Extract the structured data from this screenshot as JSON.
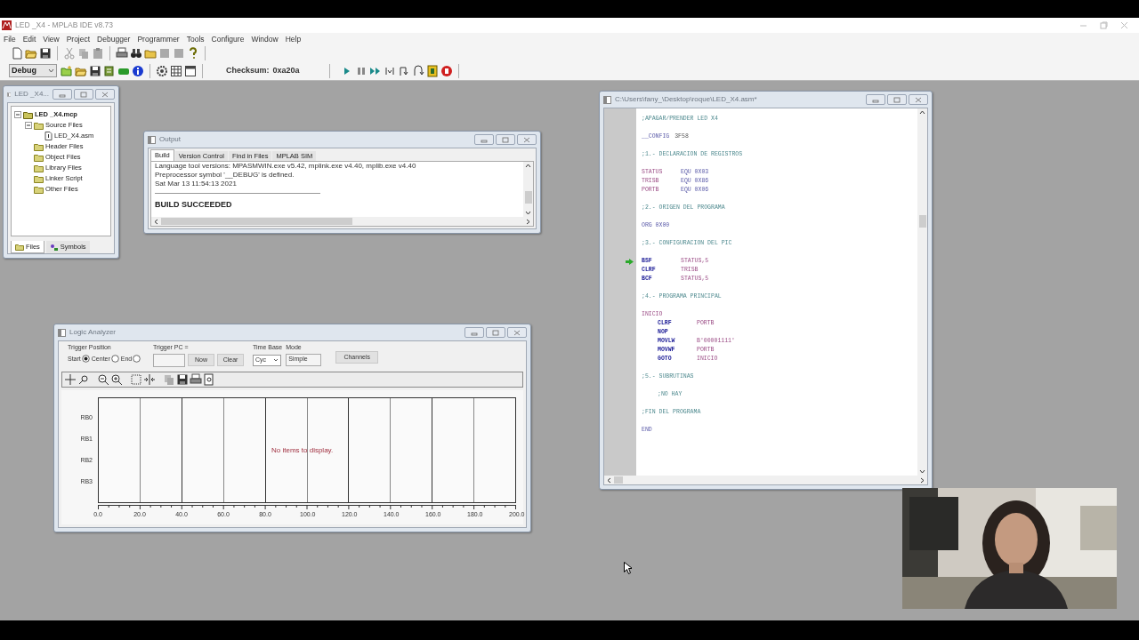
{
  "app": {
    "title": "LED _X4 - MPLAB IDE v8.73"
  },
  "menu": [
    "File",
    "Edit",
    "View",
    "Project",
    "Debugger",
    "Programmer",
    "Tools",
    "Configure",
    "Window",
    "Help"
  ],
  "toolbar": {
    "config": "Debug",
    "checksum_label": "Checksum:",
    "checksum": "0xa20a"
  },
  "project_window": {
    "title": "LED _X4...",
    "tree": [
      {
        "label": "LED _X4.mcp",
        "kind": "project",
        "expanded": true,
        "children": [
          {
            "label": "Source Files",
            "kind": "folder",
            "expanded": true,
            "children": [
              {
                "label": "LED_X4.asm",
                "kind": "file"
              }
            ]
          },
          {
            "label": "Header Files",
            "kind": "folder"
          },
          {
            "label": "Object Files",
            "kind": "folder"
          },
          {
            "label": "Library Files",
            "kind": "folder"
          },
          {
            "label": "Linker Script",
            "kind": "folder"
          },
          {
            "label": "Other Files",
            "kind": "folder"
          }
        ]
      }
    ],
    "tabs": [
      {
        "label": "Files",
        "selected": true
      },
      {
        "label": "Symbols",
        "selected": false
      }
    ]
  },
  "output_window": {
    "title": "Output",
    "tabs": [
      {
        "label": "Build",
        "selected": true
      },
      {
        "label": "Version Control",
        "selected": false
      },
      {
        "label": "Find in Files",
        "selected": false
      },
      {
        "label": "MPLAB SIM",
        "selected": false
      }
    ],
    "lines": [
      "Language tool versions: MPASMWIN.exe v5.42, mplink.exe v4.40, mplib.exe v4.40",
      "Preprocessor symbol '__DEBUG' is defined.",
      "Sat Mar 13 11:54:13 2021"
    ],
    "result": "BUILD SUCCEEDED"
  },
  "logic_analyzer": {
    "title": "Logic Analyzer",
    "trigger_position": {
      "label": "Trigger Position",
      "options": [
        {
          "label": "Start",
          "selected": true
        },
        {
          "label": "Center",
          "selected": false
        },
        {
          "label": "End",
          "selected": false
        }
      ]
    },
    "trigger_pc_label": "Trigger PC =",
    "now_button": "Now",
    "clear_button": "Clear",
    "time_base": {
      "label": "Time Base",
      "value": "Cyc"
    },
    "mode": {
      "label": "Mode",
      "value": "Simple"
    },
    "channels_button": "Channels",
    "channels": [
      "RB0",
      "RB1",
      "RB2",
      "RB3"
    ],
    "x_labels": [
      "0.0",
      "20.0",
      "40.0",
      "60.0",
      "80.0",
      "100.0",
      "120.0",
      "140.0",
      "160.0",
      "180.0",
      "200.0"
    ],
    "empty_message": "No items to display."
  },
  "editor": {
    "title": "C:\\Users\\fany_\\Desktop\\roque\\LED_X4.asm*",
    "lines": [
      {
        "kind": "code",
        "current": false,
        "tokens": [
          {
            "text": ";APAGAR/PRENDER LED X4",
            "kind": "comment"
          }
        ]
      },
      {
        "kind": "blank",
        "current": false
      },
      {
        "kind": "code",
        "current": false,
        "tokens": [
          {
            "text": "__CONFIG",
            "kind": "directive"
          },
          {
            "text": "3F58",
            "kind": "number"
          }
        ]
      },
      {
        "kind": "blank",
        "current": false
      },
      {
        "kind": "code",
        "current": false,
        "tokens": [
          {
            "text": ";1.- DECLARACION DE REGISTROS",
            "kind": "comment"
          }
        ]
      },
      {
        "kind": "blank",
        "current": false
      },
      {
        "kind": "code",
        "current": false,
        "tokens": [
          {
            "text": "STATUS",
            "kind": "symbol"
          },
          {
            "text": "EQU 0X03",
            "kind": "directive"
          }
        ]
      },
      {
        "kind": "code",
        "current": false,
        "tokens": [
          {
            "text": "TRISB",
            "kind": "symbol"
          },
          {
            "text": "EQU 0X86",
            "kind": "directive"
          }
        ]
      },
      {
        "kind": "code",
        "current": false,
        "tokens": [
          {
            "text": "PORTB",
            "kind": "symbol"
          },
          {
            "text": "EQU 0X06",
            "kind": "directive"
          }
        ]
      },
      {
        "kind": "blank",
        "current": false
      },
      {
        "kind": "code",
        "current": false,
        "tokens": [
          {
            "text": ";2.- ORIGEN DEL PROGRAMA",
            "kind": "comment"
          }
        ]
      },
      {
        "kind": "blank",
        "current": false
      },
      {
        "kind": "code",
        "current": false,
        "tokens": [
          {
            "text": "ORG 0X00",
            "kind": "directive"
          }
        ]
      },
      {
        "kind": "blank",
        "current": false
      },
      {
        "kind": "code",
        "current": false,
        "tokens": [
          {
            "text": ";3.- CONFIGURACION DEL PIC",
            "kind": "comment"
          }
        ]
      },
      {
        "kind": "blank",
        "current": false
      },
      {
        "kind": "code",
        "current": true,
        "tokens": [
          {
            "text": "BSF",
            "kind": "instruction"
          },
          {
            "text": "STATUS,5",
            "kind": "symbol"
          }
        ]
      },
      {
        "kind": "code",
        "current": false,
        "tokens": [
          {
            "text": "CLRF",
            "kind": "instruction"
          },
          {
            "text": "TRISB",
            "kind": "symbol"
          }
        ]
      },
      {
        "kind": "code",
        "current": false,
        "tokens": [
          {
            "text": "BCF",
            "kind": "instruction"
          },
          {
            "text": "STATUS,5",
            "kind": "symbol"
          }
        ]
      },
      {
        "kind": "blank",
        "current": false
      },
      {
        "kind": "code",
        "current": false,
        "tokens": [
          {
            "text": ";4.- PROGRAMA PRINCIPAL",
            "kind": "comment"
          }
        ]
      },
      {
        "kind": "blank",
        "current": false
      },
      {
        "kind": "code",
        "current": false,
        "tokens": [
          {
            "text": "INICIO",
            "kind": "symbol"
          }
        ]
      },
      {
        "kind": "indented",
        "current": false,
        "tokens": [
          {
            "text": "CLRF",
            "kind": "instruction"
          },
          {
            "text": "PORTB",
            "kind": "symbol"
          }
        ]
      },
      {
        "kind": "indented",
        "current": false,
        "tokens": [
          {
            "text": "NOP",
            "kind": "instruction"
          }
        ]
      },
      {
        "kind": "indented",
        "current": false,
        "tokens": [
          {
            "text": "MOVLW",
            "kind": "instruction"
          },
          {
            "text": "B'00001111'",
            "kind": "symbol"
          }
        ]
      },
      {
        "kind": "indented",
        "current": false,
        "tokens": [
          {
            "text": "MOVWF",
            "kind": "instruction"
          },
          {
            "text": "PORTB",
            "kind": "symbol"
          }
        ]
      },
      {
        "kind": "indented",
        "current": false,
        "tokens": [
          {
            "text": "GOTO",
            "kind": "instruction"
          },
          {
            "text": "INICIO",
            "kind": "symbol"
          }
        ]
      },
      {
        "kind": "blank",
        "current": false
      },
      {
        "kind": "code",
        "current": false,
        "tokens": [
          {
            "text": ";5.- SUBRUTINAS",
            "kind": "comment"
          }
        ]
      },
      {
        "kind": "blank",
        "current": false
      },
      {
        "kind": "indented",
        "current": false,
        "tokens": [
          {
            "text": ";NO HAY",
            "kind": "comment"
          }
        ]
      },
      {
        "kind": "blank",
        "current": false
      },
      {
        "kind": "code",
        "current": false,
        "tokens": [
          {
            "text": ";FIN DEL PROGRAMA",
            "kind": "comment"
          }
        ]
      },
      {
        "kind": "blank",
        "current": false
      },
      {
        "kind": "code",
        "current": false,
        "tokens": [
          {
            "text": "END",
            "kind": "directive"
          }
        ]
      }
    ]
  }
}
